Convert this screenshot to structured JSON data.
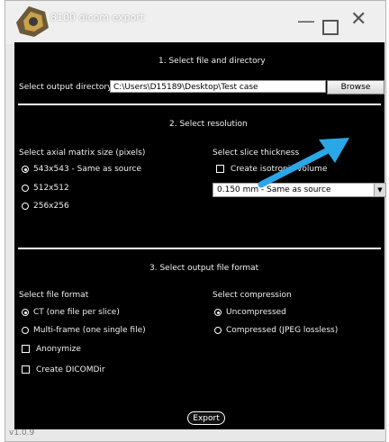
{
  "window": {
    "title": "8100 dicom export",
    "minimize_glyph": "—",
    "close_glyph": "✕",
    "version": "v1.0.9"
  },
  "section1": {
    "title": "1. Select file and directory",
    "output_label": "Select output directory",
    "output_path": "C:\\Users\\D15189\\Desktop\\Test case",
    "browse_label": "Browse"
  },
  "section2": {
    "title": "2. Select resolution",
    "matrix_label": "Select axial matrix size (pixels)",
    "matrix_options": [
      "543x543 - Same as source",
      "512x512",
      "256x256"
    ],
    "matrix_selected": 0,
    "thickness_label": "Select slice thickness",
    "isotropic_label": "Create isotropic volume",
    "isotropic_checked": false,
    "thickness_value": "0.150 mm - Same as source"
  },
  "section3": {
    "title": "3. Select output file format",
    "format_label": "Select file format",
    "format_options": [
      "CT (one file per slice)",
      "Multi-frame (one single file)"
    ],
    "format_selected": 0,
    "anonymize_label": "Anonymize",
    "dicomdir_label": "Create DICOMDir",
    "compression_label": "Select compression",
    "compression_options": [
      "Uncompressed",
      "Compressed (JPEG lossless)"
    ],
    "compression_selected": 0,
    "export_label": "Export"
  },
  "colors": {
    "panel_background": "#000000",
    "annotation_arrow": "#2aa7e6"
  }
}
